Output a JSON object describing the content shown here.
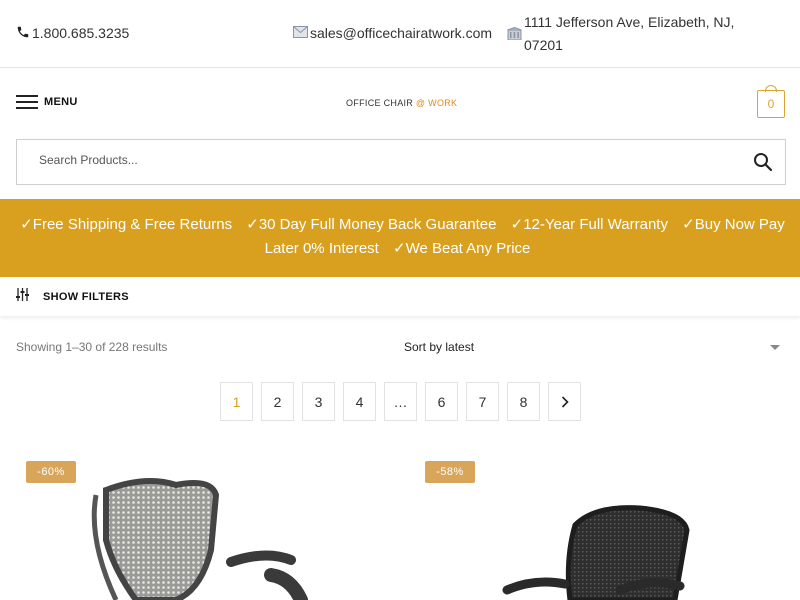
{
  "topbar": {
    "phone": "1.800.685.3235",
    "email": "sales@officechairatwork.com",
    "address": "1111 Jefferson Ave, Elizabeth, NJ, 07201"
  },
  "header": {
    "menu_label": "MENU",
    "logo_text": "OFFICE CHAIR ",
    "logo_accent": "@ WORK",
    "cart_count": "0"
  },
  "search": {
    "placeholder": "Search Products..."
  },
  "banner": {
    "items": [
      "✓Free Shipping & Free Returns",
      "✓30 Day Full Money Back Guarantee",
      "✓12-Year Full Warranty",
      "✓Buy Now Pay Later 0% Interest",
      "✓We Beat Any Price"
    ]
  },
  "filters": {
    "label": "SHOW FILTERS"
  },
  "listing": {
    "results_text": "Showing 1–30 of 228 results",
    "sort_label": "Sort by latest"
  },
  "pagination": {
    "pages": [
      "1",
      "2",
      "3",
      "4",
      "…",
      "6",
      "7",
      "8"
    ]
  },
  "products": [
    {
      "badge": "-60%"
    },
    {
      "badge": "-58%"
    }
  ],
  "colors": {
    "accent": "#d9a020",
    "badge": "#d9a55a"
  }
}
